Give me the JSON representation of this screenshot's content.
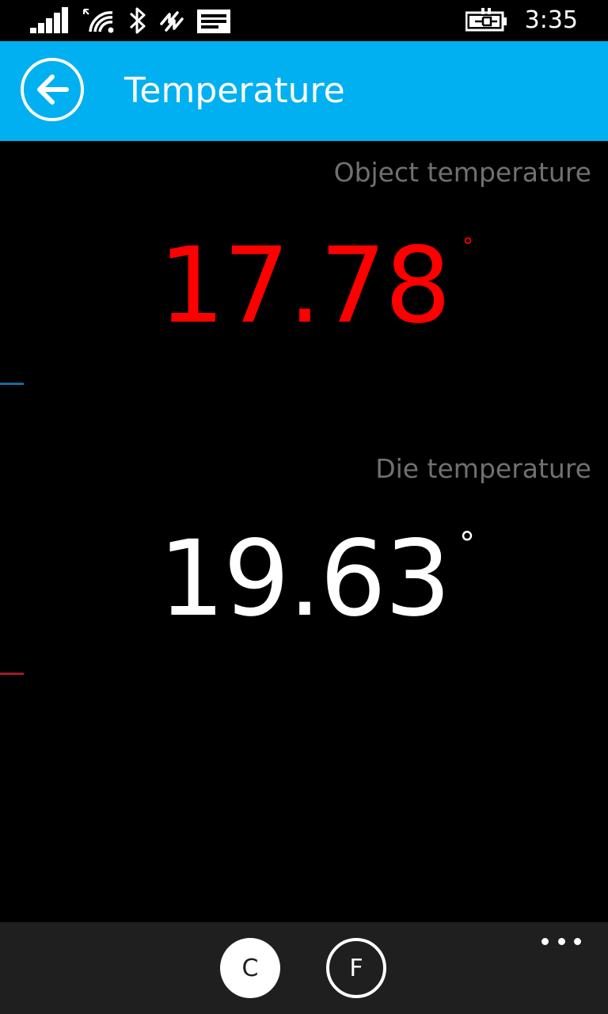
{
  "status_bar": {
    "time": "3:35",
    "icons": [
      "signal-strength-icon",
      "wifi-icon",
      "bluetooth-icon",
      "data-sync-icon",
      "message-icon",
      "battery-charging-icon"
    ]
  },
  "header": {
    "title": "Temperature",
    "back_icon": "back-arrow-icon",
    "background_color": "#00b0f0"
  },
  "object_temperature": {
    "label": "Object temperature",
    "value": "17.78",
    "unit_symbol": "°",
    "color": "#ff0000"
  },
  "die_temperature": {
    "label": "Die temperature",
    "value": "19.63",
    "unit_symbol": "°",
    "color": "#ffffff"
  },
  "app_bar": {
    "celsius_label": "C",
    "fahrenheit_label": "F",
    "selected_unit": "C",
    "more_icon": "more-ellipsis-icon"
  }
}
